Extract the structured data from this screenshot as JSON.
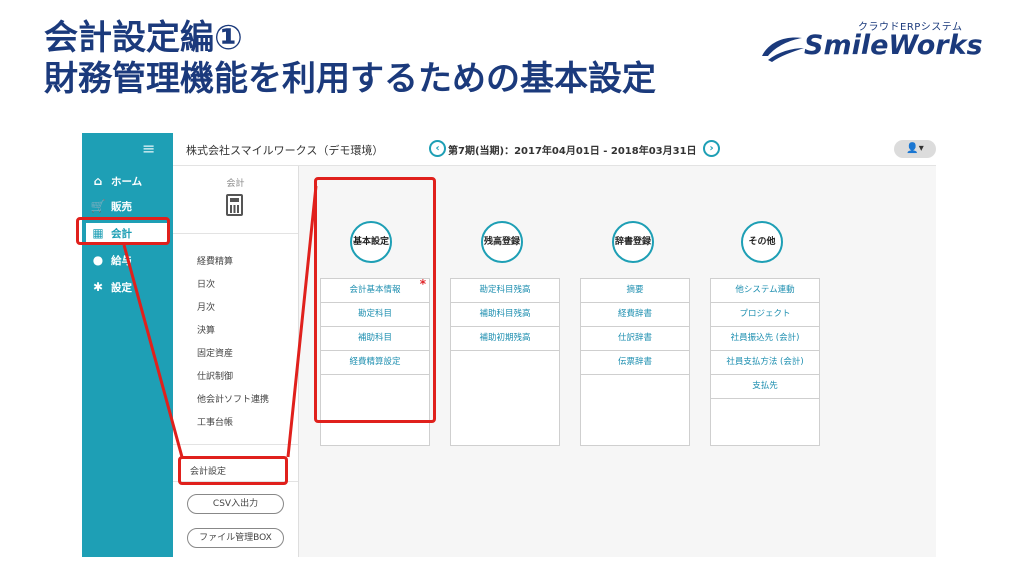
{
  "slide": {
    "title_line1": "会計設定編①",
    "title_line2": "財務管理機能を利用するための基本設定"
  },
  "logo": {
    "subtitle": "クラウドERPシステム",
    "name": "SmileWorks"
  },
  "app": {
    "company": "株式会社スマイルワークス（デモ環境）",
    "period": "第7期(当期)：2017年04月01日 - 2018年03月31日",
    "prev_icon": "‹",
    "next_icon": "›",
    "user_icon": "👤▾",
    "nav": {
      "menu_icon": "≡",
      "items": [
        {
          "label": "ホーム",
          "icon": "⌂"
        },
        {
          "label": "販売",
          "icon": "🛒"
        },
        {
          "label": "会計",
          "icon": "▦"
        },
        {
          "label": "給与",
          "icon": "●"
        },
        {
          "label": "設定",
          "icon": "✱"
        }
      ]
    },
    "subnav": {
      "header": "会計",
      "items": [
        "経費精算",
        "日次",
        "月次",
        "決算",
        "固定資産",
        "仕訳制御",
        "他会計ソフト連携",
        "工事台帳"
      ],
      "settings": "会計設定",
      "buttons": [
        "CSV入出力",
        "ファイル管理BOX"
      ]
    },
    "categories": [
      {
        "title": "基本設定",
        "items": [
          "会計基本情報",
          "勘定科目",
          "補助科目",
          "経費精算設定"
        ],
        "required_mark": "*"
      },
      {
        "title": "残高登録",
        "items": [
          "勘定科目残高",
          "補助科目残高",
          "補助初期残高"
        ]
      },
      {
        "title": "辞書登録",
        "items": [
          "摘要",
          "経費辞書",
          "仕訳辞書",
          "伝票辞書"
        ]
      },
      {
        "title": "その他",
        "items": [
          "他システム連動",
          "プロジェクト",
          "社員振込先 (会計)",
          "社員支払方法 (会計)",
          "支払先"
        ]
      }
    ]
  },
  "colors": {
    "title": "#1b3a7c",
    "sidebar": "#1e9fb5",
    "highlight": "#e0201c"
  }
}
